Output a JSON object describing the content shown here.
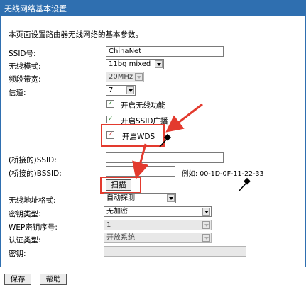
{
  "title": "无线网络基本设置",
  "description": "本页面设置路由器无线网络的基本参数。",
  "fields": {
    "ssid_label": "SSID号:",
    "ssid_value": "ChinaNet",
    "mode_label": "无线模式:",
    "mode_value": "11bg mixed",
    "bandwidth_label": "频段带宽:",
    "bandwidth_value": "20MHz",
    "channel_label": "信道:",
    "channel_value": "7"
  },
  "checkboxes": {
    "enable_wireless": "开启无线功能",
    "enable_ssid_broadcast": "开启SSID广播",
    "enable_wds": "开启WDS"
  },
  "wds": {
    "bridge_ssid_label": "(桥接的)SSID:",
    "bridge_ssid_value": "",
    "bridge_bssid_label": "(桥接的)BSSID:",
    "bridge_bssid_value": "",
    "example_text": "例如: 00-1D-0F-11-22-33",
    "scan_label": "扫描",
    "address_format_label": "无线地址格式:",
    "address_format_value": "自动探测",
    "key_type_label": "密钥类型:",
    "key_type_value": "无加密",
    "wep_index_label": "WEP密钥序号:",
    "wep_index_value": "1",
    "auth_type_label": "认证类型:",
    "auth_type_value": "开放系统",
    "key_label": "密钥:",
    "key_value": ""
  },
  "buttons": {
    "save": "保存",
    "help": "帮助"
  },
  "colors": {
    "titlebar": "#2f6fb0",
    "highlight_red": "#e33a2e"
  }
}
